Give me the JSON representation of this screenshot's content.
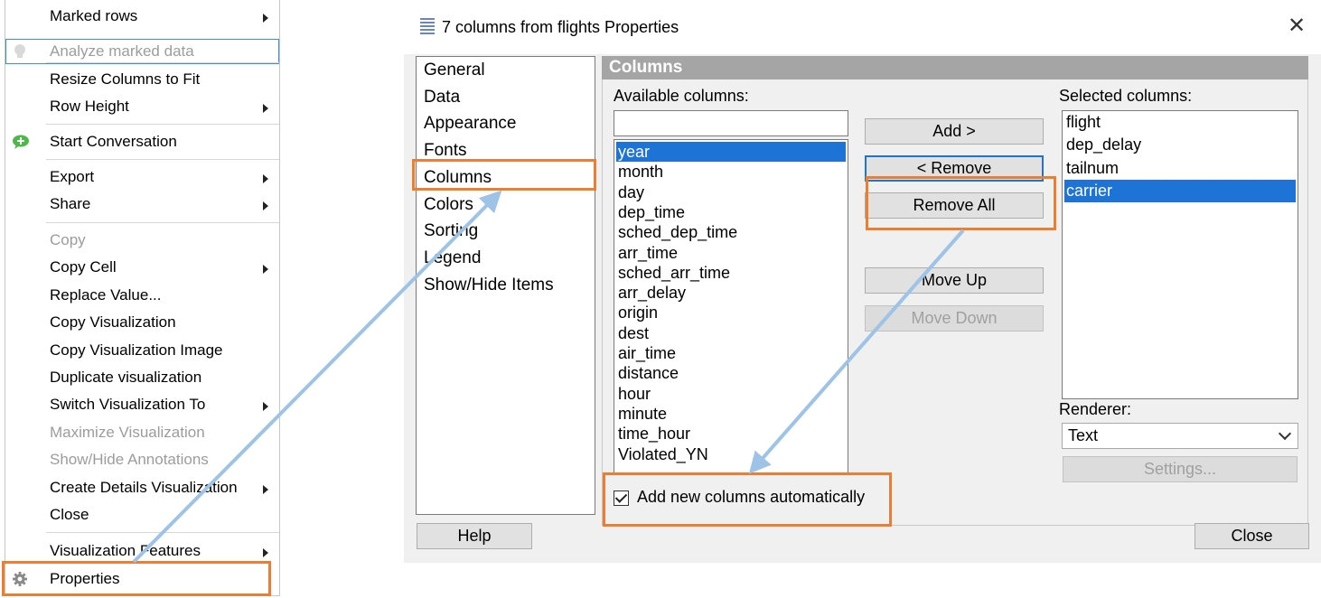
{
  "context_menu": {
    "items": [
      {
        "label": "Marked rows",
        "submenu": true,
        "disabled": false
      },
      {
        "label": "Analyze marked data",
        "submenu": false,
        "disabled": true,
        "icon": "lightbulb-icon"
      },
      {
        "label": "Resize Columns to Fit",
        "submenu": false,
        "disabled": false
      },
      {
        "label": "Row Height",
        "submenu": true,
        "disabled": false
      },
      {
        "label": "Start Conversation",
        "submenu": false,
        "disabled": false,
        "icon": "add-comment-icon"
      },
      {
        "label": "Export",
        "submenu": true,
        "disabled": false
      },
      {
        "label": "Share",
        "submenu": true,
        "disabled": false
      },
      {
        "label": "Copy",
        "submenu": false,
        "disabled": true
      },
      {
        "label": "Copy Cell",
        "submenu": true,
        "disabled": false
      },
      {
        "label": "Replace Value...",
        "submenu": false,
        "disabled": false
      },
      {
        "label": "Copy Visualization",
        "submenu": false,
        "disabled": false
      },
      {
        "label": "Copy Visualization Image",
        "submenu": false,
        "disabled": false
      },
      {
        "label": "Duplicate visualization",
        "submenu": false,
        "disabled": false
      },
      {
        "label": "Switch Visualization To",
        "submenu": true,
        "disabled": false
      },
      {
        "label": "Maximize Visualization",
        "submenu": false,
        "disabled": true
      },
      {
        "label": "Show/Hide Annotations",
        "submenu": false,
        "disabled": true
      },
      {
        "label": "Create Details Visualization",
        "submenu": true,
        "disabled": false
      },
      {
        "label": "Close",
        "submenu": false,
        "disabled": false
      },
      {
        "label": "Visualization Features",
        "submenu": true,
        "disabled": false
      },
      {
        "label": "Properties",
        "submenu": false,
        "disabled": false,
        "icon": "gear-icon"
      }
    ]
  },
  "dialog": {
    "title": "7 columns from flights Properties",
    "close_glyph": "✕",
    "nav": [
      "General",
      "Data",
      "Appearance",
      "Fonts",
      "Columns",
      "Colors",
      "Sorting",
      "Legend",
      "Show/Hide Items"
    ],
    "selected_nav": "Columns",
    "section_title": "Columns",
    "available_label": "Available columns:",
    "filter_value": "",
    "available_columns": [
      "year",
      "month",
      "day",
      "dep_time",
      "sched_dep_time",
      "arr_time",
      "sched_arr_time",
      "arr_delay",
      "origin",
      "dest",
      "air_time",
      "distance",
      "hour",
      "minute",
      "time_hour",
      "Violated_YN"
    ],
    "available_selected": "year",
    "buttons": {
      "add": "Add >",
      "remove": "< Remove",
      "remove_all": "Remove All",
      "move_up": "Move Up",
      "move_down": "Move Down",
      "settings": "Settings...",
      "help": "Help",
      "close": "Close"
    },
    "selected_label": "Selected columns:",
    "selected_columns": [
      "flight",
      "dep_delay",
      "tailnum",
      "carrier"
    ],
    "selected_selected": "carrier",
    "renderer_label": "Renderer:",
    "renderer_value": "Text",
    "auto_add_label": "Add new columns automatically",
    "auto_add_checked": true
  },
  "colors": {
    "highlight": "#ed7d31",
    "arrow": "#9dc3e6",
    "selection": "#1e73d6"
  }
}
